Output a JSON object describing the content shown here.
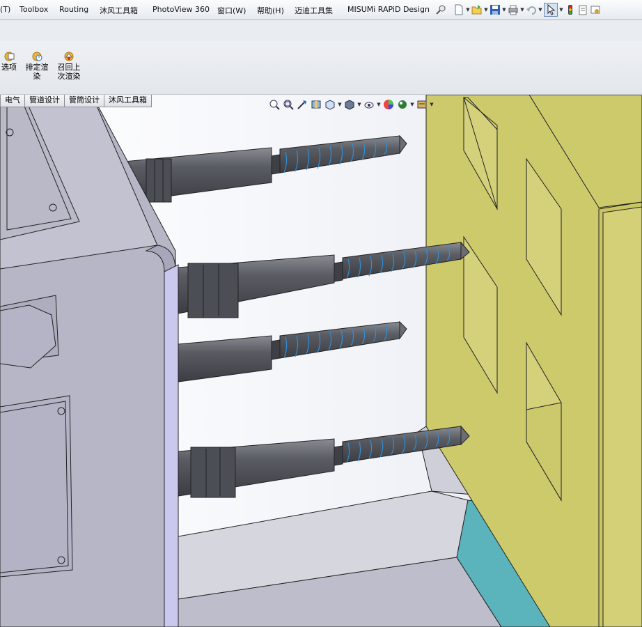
{
  "menu": {
    "items": [
      "(T)",
      "Toolbox",
      "Routing",
      "沐风工具箱",
      "PhotoView 360",
      "窗口(W)",
      "帮助(H)",
      "迈迪工具集",
      "MISUMi RAPiD Design"
    ]
  },
  "command_manager": {
    "buttons": [
      {
        "label": "选项"
      },
      {
        "label": "排定渲染"
      },
      {
        "label": "召回上次渲染"
      }
    ]
  },
  "tabs": [
    "电气",
    "管道设计",
    "管筒设计",
    "沐风工具箱"
  ],
  "icons": {
    "quick_access": [
      "pin-icon",
      "new-document-icon",
      "open-folder-icon",
      "save-icon",
      "print-icon",
      "undo-icon",
      "select-pointer-icon",
      "traffic-light-icon",
      "file-properties-icon",
      "options-icon"
    ],
    "heads_up": [
      "zoom-to-fit-icon",
      "zoom-to-area-icon",
      "previous-view-icon",
      "section-view-icon",
      "view-orientation-icon",
      "display-style-icon",
      "hide-show-items-icon",
      "edit-appearance-icon",
      "apply-scene-icon",
      "view-settings-icon"
    ]
  },
  "colors": {
    "body_gray": "#b6b6c6",
    "plate_yellow": "#cdca6c",
    "screw_dark": "#5b5d63",
    "thread_blue": "#2f8fd8",
    "teal": "#5bb4bc"
  }
}
